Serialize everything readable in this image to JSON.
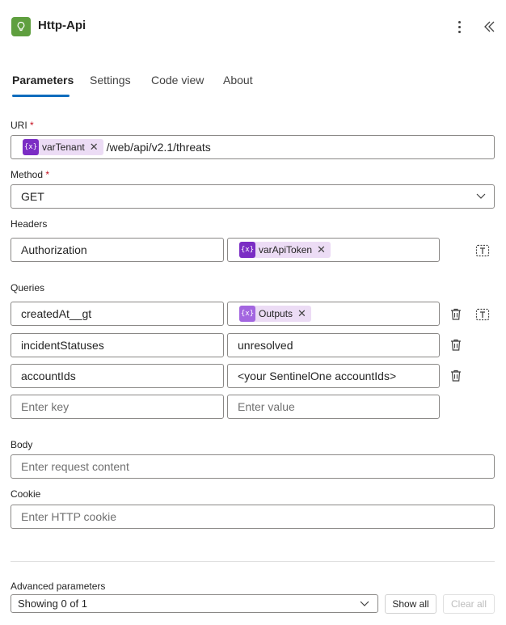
{
  "header": {
    "title": "Http-Api",
    "app_icon": "lightbulb-icon",
    "more_icon": "more-vertical-icon",
    "collapse_icon": "double-chevron-left-icon"
  },
  "tabs": [
    {
      "label": "Parameters",
      "active": true
    },
    {
      "label": "Settings",
      "active": false
    },
    {
      "label": "Code view",
      "active": false
    },
    {
      "label": "About",
      "active": false
    }
  ],
  "uri": {
    "label": "URI",
    "required_mark": "*",
    "token": "varTenant",
    "token_icon": "{x}",
    "path": "/web/api/v2.1/threats"
  },
  "method": {
    "label": "Method",
    "required_mark": "*",
    "value": "GET"
  },
  "headers": {
    "label": "Headers",
    "rows": [
      {
        "key": "Authorization",
        "token": "varApiToken",
        "token_icon": "{x}"
      }
    ]
  },
  "queries": {
    "label": "Queries",
    "rows": [
      {
        "key": "createdAt__gt",
        "token": "Outputs",
        "token_icon": "{x}"
      },
      {
        "key": "incidentStatuses",
        "value": "unresolved"
      },
      {
        "key": "accountIds",
        "value": "<your SentinelOne accountIds>"
      }
    ],
    "key_placeholder": "Enter key",
    "value_placeholder": "Enter value"
  },
  "body": {
    "label": "Body",
    "placeholder": "Enter request content"
  },
  "cookie": {
    "label": "Cookie",
    "placeholder": "Enter HTTP cookie"
  },
  "advanced": {
    "label": "Advanced parameters",
    "value": "Showing 0 of 1",
    "show_all": "Show all",
    "clear_all": "Clear all"
  },
  "colors": {
    "accent": "#0f6cbd",
    "token_bg": "#ecdcf5",
    "token_icon": "#7b2dc4",
    "app_icon": "#5f9f3f",
    "required": "#c50f1f"
  }
}
